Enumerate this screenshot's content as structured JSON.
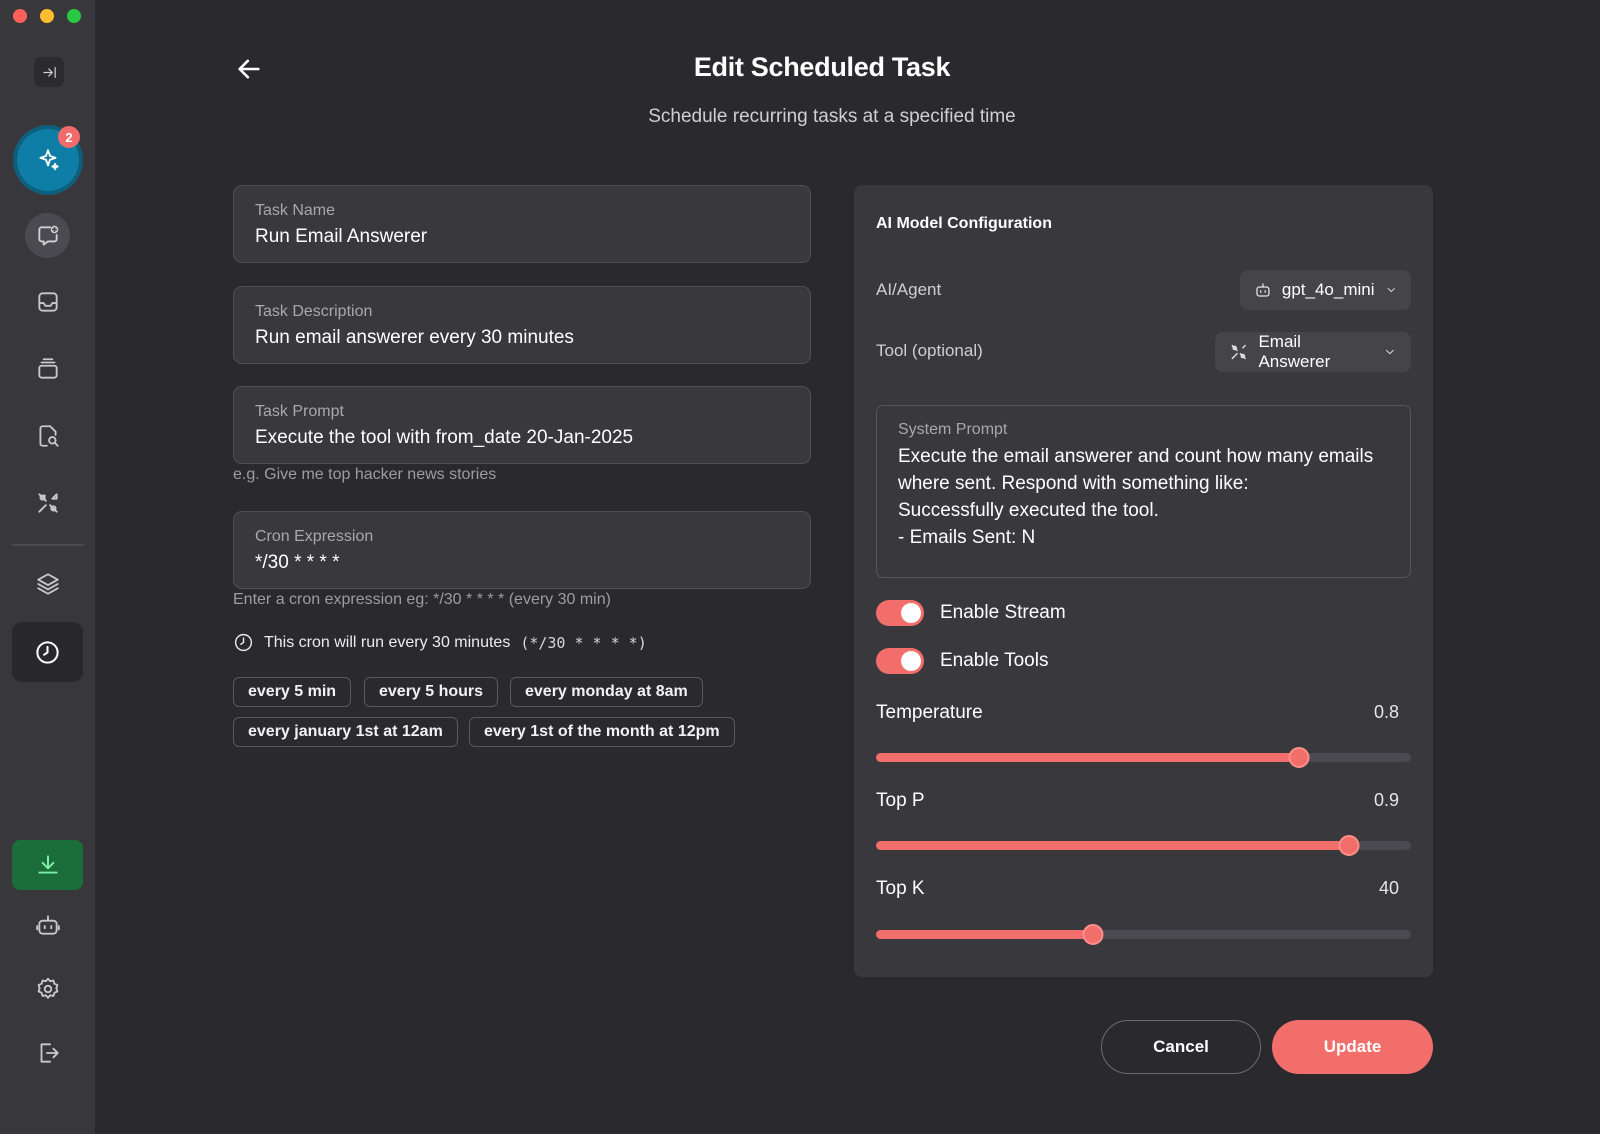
{
  "header": {
    "title": "Edit Scheduled Task",
    "subtitle": "Schedule recurring tasks at a specified time"
  },
  "sidebar": {
    "badge_count": "2",
    "items": [
      {
        "icon": "collapse-sidebar-icon"
      },
      {
        "icon": "sparkles-icon"
      },
      {
        "icon": "new-chat-icon"
      },
      {
        "icon": "inbox-icon"
      },
      {
        "icon": "stack-icon"
      },
      {
        "icon": "file-search-icon"
      },
      {
        "icon": "tools-icon"
      },
      {
        "icon": "layers-icon"
      },
      {
        "icon": "clock-icon"
      },
      {
        "icon": "download-icon"
      },
      {
        "icon": "robot-icon"
      },
      {
        "icon": "gear-icon"
      },
      {
        "icon": "logout-icon"
      }
    ]
  },
  "form": {
    "task_name": {
      "label": "Task Name",
      "value": "Run Email Answerer"
    },
    "task_description": {
      "label": "Task Description",
      "value": "Run email answerer every 30 minutes"
    },
    "task_prompt": {
      "label": "Task Prompt",
      "value": "Execute the tool with from_date 20-Jan-2025",
      "hint": "e.g. Give me top hacker news stories"
    },
    "cron": {
      "label": "Cron Expression",
      "value": "*/30 * * * *",
      "hint": "Enter a cron expression eg: */30 * * * * (every 30 min)"
    },
    "cron_info": {
      "text": "This cron will run every 30 minutes",
      "expression": "(*/30 * * * *)"
    },
    "presets": [
      "every 5 min",
      "every 5 hours",
      "every monday at 8am",
      "every january 1st at 12am",
      "every 1st of the month at 12pm"
    ]
  },
  "model_config": {
    "title": "AI Model Configuration",
    "agent_label": "AI/Agent",
    "agent_value": "gpt_4o_mini",
    "tool_label": "Tool (optional)",
    "tool_value": "Email Answerer",
    "system_prompt": {
      "label": "System Prompt",
      "value": "Execute the email answerer and count how many emails where sent. Respond with something like:\nSuccessfully executed the tool.\n- Emails Sent: N"
    },
    "enable_stream": {
      "label": "Enable Stream",
      "on": true
    },
    "enable_tools": {
      "label": "Enable Tools",
      "on": true
    },
    "temperature": {
      "label": "Temperature",
      "display": "0.8",
      "fraction": 0.79
    },
    "top_p": {
      "label": "Top P",
      "display": "0.9",
      "fraction": 0.885
    },
    "top_k": {
      "label": "Top K",
      "display": "40",
      "fraction": 0.405
    },
    "accent_color": "#f26e6b"
  },
  "actions": {
    "cancel": "Cancel",
    "update": "Update"
  }
}
